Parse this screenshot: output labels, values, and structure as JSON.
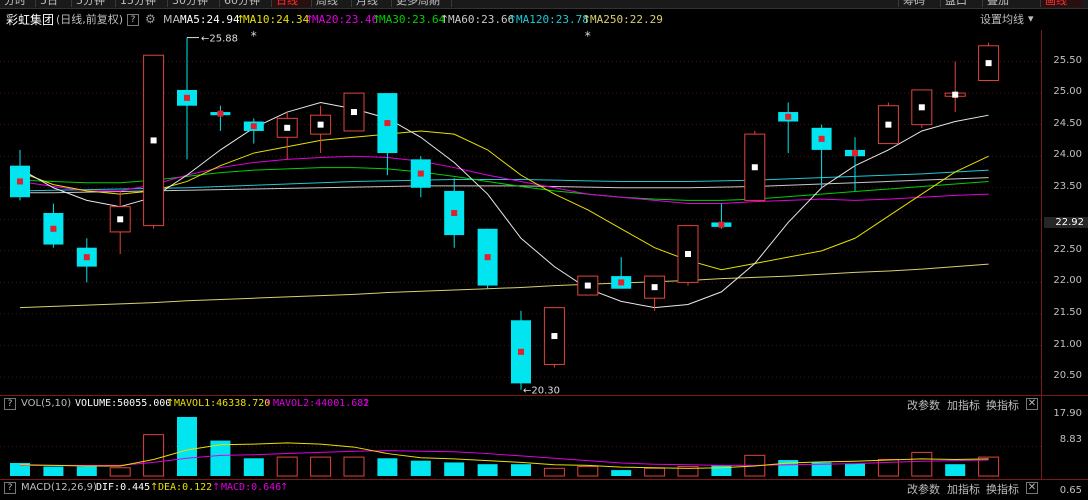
{
  "top_tabs": {
    "periods": [
      "分时",
      "5日",
      "5分钟",
      "15分钟",
      "30分钟",
      "60分钟",
      "日线",
      "周线",
      "月线",
      "更多周期"
    ],
    "active_period": "日线",
    "right": [
      "筹码",
      "盘口",
      "叠加",
      "画线"
    ],
    "active_right": "画线"
  },
  "info": {
    "stock_name": "彩虹集团",
    "mode": "(日线,前复权)",
    "help_icon": "?",
    "ma": "MA",
    "ma5": "MA5:24.94",
    "ma10": "MA10:24.34",
    "ma20": "MA20:23.46",
    "ma30": "MA30:23.64",
    "ma60": "MA60:23.66",
    "ma120": "MA120:23.78",
    "ma250": "MA250:22.29",
    "settings": "设置均线"
  },
  "colors": {
    "up": "#e0443c",
    "down": "#00e5f0",
    "ma5": "#e8e8e8",
    "ma10": "#e8e000",
    "ma20": "#e000e0",
    "ma30": "#00d000",
    "ma60": "#c8c8c8",
    "ma120": "#20c8d8",
    "ma250": "#d8d070",
    "background": "#000000",
    "accent_red": "#ff3030"
  },
  "annotations": {
    "high": "25.88",
    "low": "20.30",
    "star": "*"
  },
  "axis_main": {
    "ticks": [
      "25.50",
      "25.00",
      "24.50",
      "24.00",
      "23.50",
      "22.92",
      "22.50",
      "22.00",
      "21.50",
      "21.00",
      "20.50"
    ],
    "current": "22.92"
  },
  "axis_vol": {
    "ticks": [
      "17.90",
      "8.83"
    ]
  },
  "axis_macd": {
    "ticks": [
      "0.65"
    ]
  },
  "vol_panel": {
    "title": "VOL(5,10)",
    "volume": "VOLUME:50055.000",
    "mavol1": "MAVOL1:46338.720",
    "mavol2": "MAVOL2:44001.682",
    "buttons": [
      "改参数",
      "加指标",
      "换指标"
    ]
  },
  "macd_panel": {
    "title": "MACD(12,26,9)",
    "dif": "DIF:0.445",
    "dea": "DEA:0.122",
    "macd": "MACD:0.646",
    "buttons": [
      "改参数",
      "加指标",
      "换指标"
    ]
  },
  "chart_data": {
    "type": "candlestick",
    "note": "",
    "candles": [
      {
        "o": 23.85,
        "c": 23.35,
        "h": 24.1,
        "l": 23.3
      },
      {
        "o": 23.1,
        "c": 22.6,
        "h": 23.25,
        "l": 22.55
      },
      {
        "o": 22.55,
        "c": 22.25,
        "h": 22.7,
        "l": 22.0
      },
      {
        "o": 22.8,
        "c": 23.2,
        "h": 23.45,
        "l": 22.45
      },
      {
        "o": 22.9,
        "c": 25.6,
        "h": 25.6,
        "l": 22.85
      },
      {
        "o": 25.05,
        "c": 24.8,
        "h": 25.88,
        "l": 23.95
      },
      {
        "o": 24.7,
        "c": 24.65,
        "h": 24.8,
        "l": 24.4
      },
      {
        "o": 24.55,
        "c": 24.4,
        "h": 24.6,
        "l": 24.2
      },
      {
        "o": 24.3,
        "c": 24.6,
        "h": 24.7,
        "l": 23.95
      },
      {
        "o": 24.35,
        "c": 24.65,
        "h": 24.8,
        "l": 24.05
      },
      {
        "o": 24.4,
        "c": 25.0,
        "h": 25.0,
        "l": 24.4
      },
      {
        "o": 25.0,
        "c": 24.05,
        "h": 25.0,
        "l": 23.7
      },
      {
        "o": 23.95,
        "c": 23.5,
        "h": 24.0,
        "l": 23.35
      },
      {
        "o": 23.45,
        "c": 22.75,
        "h": 23.65,
        "l": 22.55
      },
      {
        "o": 22.85,
        "c": 21.95,
        "h": 22.85,
        "l": 21.9
      },
      {
        "o": 21.4,
        "c": 20.4,
        "h": 21.55,
        "l": 20.3
      },
      {
        "o": 20.7,
        "c": 21.6,
        "h": 21.6,
        "l": 20.65
      },
      {
        "o": 21.8,
        "c": 22.1,
        "h": 22.1,
        "l": 21.8
      },
      {
        "o": 22.1,
        "c": 21.9,
        "h": 22.4,
        "l": 21.9
      },
      {
        "o": 21.75,
        "c": 22.1,
        "h": 22.1,
        "l": 21.55
      },
      {
        "o": 22.0,
        "c": 22.9,
        "h": 22.9,
        "l": 21.95
      },
      {
        "o": 22.95,
        "c": 22.88,
        "h": 23.25,
        "l": 22.85
      },
      {
        "o": 23.3,
        "c": 24.35,
        "h": 24.4,
        "l": 23.3
      },
      {
        "o": 24.7,
        "c": 24.55,
        "h": 24.85,
        "l": 24.05
      },
      {
        "o": 24.45,
        "c": 24.1,
        "h": 24.5,
        "l": 23.5
      },
      {
        "o": 24.1,
        "c": 24.0,
        "h": 24.3,
        "l": 23.45
      },
      {
        "o": 24.2,
        "c": 24.8,
        "h": 24.85,
        "l": 24.2
      },
      {
        "o": 24.5,
        "c": 25.05,
        "h": 25.05,
        "l": 24.45
      },
      {
        "o": 24.95,
        "c": 25.0,
        "h": 25.5,
        "l": 24.7
      },
      {
        "o": 25.2,
        "c": 25.75,
        "h": 25.8,
        "l": 25.2
      }
    ],
    "ma5": [
      23.8,
      23.5,
      23.3,
      23.2,
      23.35,
      23.7,
      24.1,
      24.45,
      24.7,
      24.85,
      24.75,
      24.6,
      24.3,
      23.9,
      23.4,
      22.7,
      22.25,
      21.9,
      21.7,
      21.6,
      21.65,
      21.85,
      22.3,
      22.95,
      23.5,
      23.85,
      24.1,
      24.4,
      24.55,
      24.65
    ],
    "ma10": [
      23.75,
      23.55,
      23.45,
      23.4,
      23.45,
      23.6,
      23.85,
      24.05,
      24.15,
      24.25,
      24.3,
      24.35,
      24.4,
      24.35,
      24.1,
      23.7,
      23.4,
      23.15,
      22.85,
      22.55,
      22.35,
      22.2,
      22.3,
      22.4,
      22.5,
      22.7,
      23.05,
      23.4,
      23.75,
      24.0
    ],
    "ma20": [
      23.6,
      23.52,
      23.45,
      23.45,
      23.55,
      23.7,
      23.82,
      23.9,
      23.95,
      23.98,
      24.0,
      23.98,
      23.92,
      23.82,
      23.7,
      23.6,
      23.5,
      23.4,
      23.35,
      23.3,
      23.25,
      23.25,
      23.28,
      23.3,
      23.32,
      23.3,
      23.32,
      23.35,
      23.38,
      23.4
    ],
    "ma30": [
      23.62,
      23.6,
      23.58,
      23.58,
      23.62,
      23.68,
      23.74,
      23.78,
      23.8,
      23.82,
      23.82,
      23.8,
      23.75,
      23.68,
      23.6,
      23.52,
      23.45,
      23.4,
      23.35,
      23.32,
      23.3,
      23.3,
      23.32,
      23.36,
      23.4,
      23.44,
      23.48,
      23.52,
      23.56,
      23.6
    ],
    "ma60": [
      23.42,
      23.42,
      23.43,
      23.44,
      23.45,
      23.46,
      23.47,
      23.48,
      23.49,
      23.5,
      23.51,
      23.52,
      23.53,
      23.53,
      23.53,
      23.53,
      23.52,
      23.51,
      23.5,
      23.5,
      23.5,
      23.51,
      23.52,
      23.54,
      23.56,
      23.58,
      23.6,
      23.62,
      23.64,
      23.66
    ],
    "ma120": [
      23.45,
      23.46,
      23.47,
      23.48,
      23.49,
      23.5,
      23.52,
      23.54,
      23.56,
      23.58,
      23.6,
      23.61,
      23.62,
      23.63,
      23.63,
      23.63,
      23.62,
      23.61,
      23.6,
      23.6,
      23.6,
      23.61,
      23.62,
      23.64,
      23.66,
      23.68,
      23.7,
      23.72,
      23.75,
      23.78
    ],
    "ma250": [
      21.6,
      21.62,
      21.64,
      21.66,
      21.68,
      21.71,
      21.73,
      21.75,
      21.77,
      21.79,
      21.81,
      21.84,
      21.86,
      21.88,
      21.9,
      21.92,
      21.95,
      21.97,
      21.99,
      22.01,
      22.03,
      22.06,
      22.08,
      22.1,
      22.13,
      22.16,
      22.18,
      22.21,
      22.25,
      22.29
    ],
    "price_range": [
      20.2,
      26.0
    ],
    "volume": [
      2.2,
      1.6,
      1.6,
      1.4,
      7.0,
      10.0,
      6.0,
      3.0,
      3.2,
      3.2,
      3.2,
      3.0,
      2.6,
      2.3,
      2.0,
      2.0,
      1.3,
      1.6,
      1.0,
      1.3,
      1.6,
      1.8,
      3.5,
      2.7,
      2.3,
      2.1,
      2.8,
      4.0,
      2.0,
      3.2
    ],
    "volume_up": [
      false,
      false,
      false,
      true,
      true,
      false,
      false,
      false,
      true,
      true,
      true,
      false,
      false,
      false,
      false,
      false,
      true,
      true,
      false,
      true,
      true,
      false,
      true,
      false,
      false,
      false,
      true,
      true,
      false,
      true
    ],
    "mavol1": [
      1.9,
      1.8,
      1.7,
      1.7,
      2.8,
      4.4,
      5.3,
      5.4,
      5.6,
      5.4,
      4.9,
      3.8,
      3.1,
      2.9,
      2.6,
      2.3,
      1.9,
      1.8,
      1.5,
      1.4,
      1.3,
      1.4,
      1.7,
      2.2,
      2.4,
      2.5,
      2.7,
      2.9,
      2.8,
      2.9
    ],
    "mavol2": [
      1.8,
      1.8,
      1.8,
      1.8,
      2.3,
      3.0,
      3.5,
      3.6,
      3.8,
      4.0,
      4.2,
      4.3,
      4.2,
      4.1,
      3.8,
      3.4,
      3.0,
      2.6,
      2.2,
      2.0,
      1.9,
      1.8,
      1.8,
      1.9,
      2.0,
      2.1,
      2.3,
      2.5,
      2.6,
      2.7
    ],
    "volume_range": [
      0,
      10.5
    ]
  }
}
